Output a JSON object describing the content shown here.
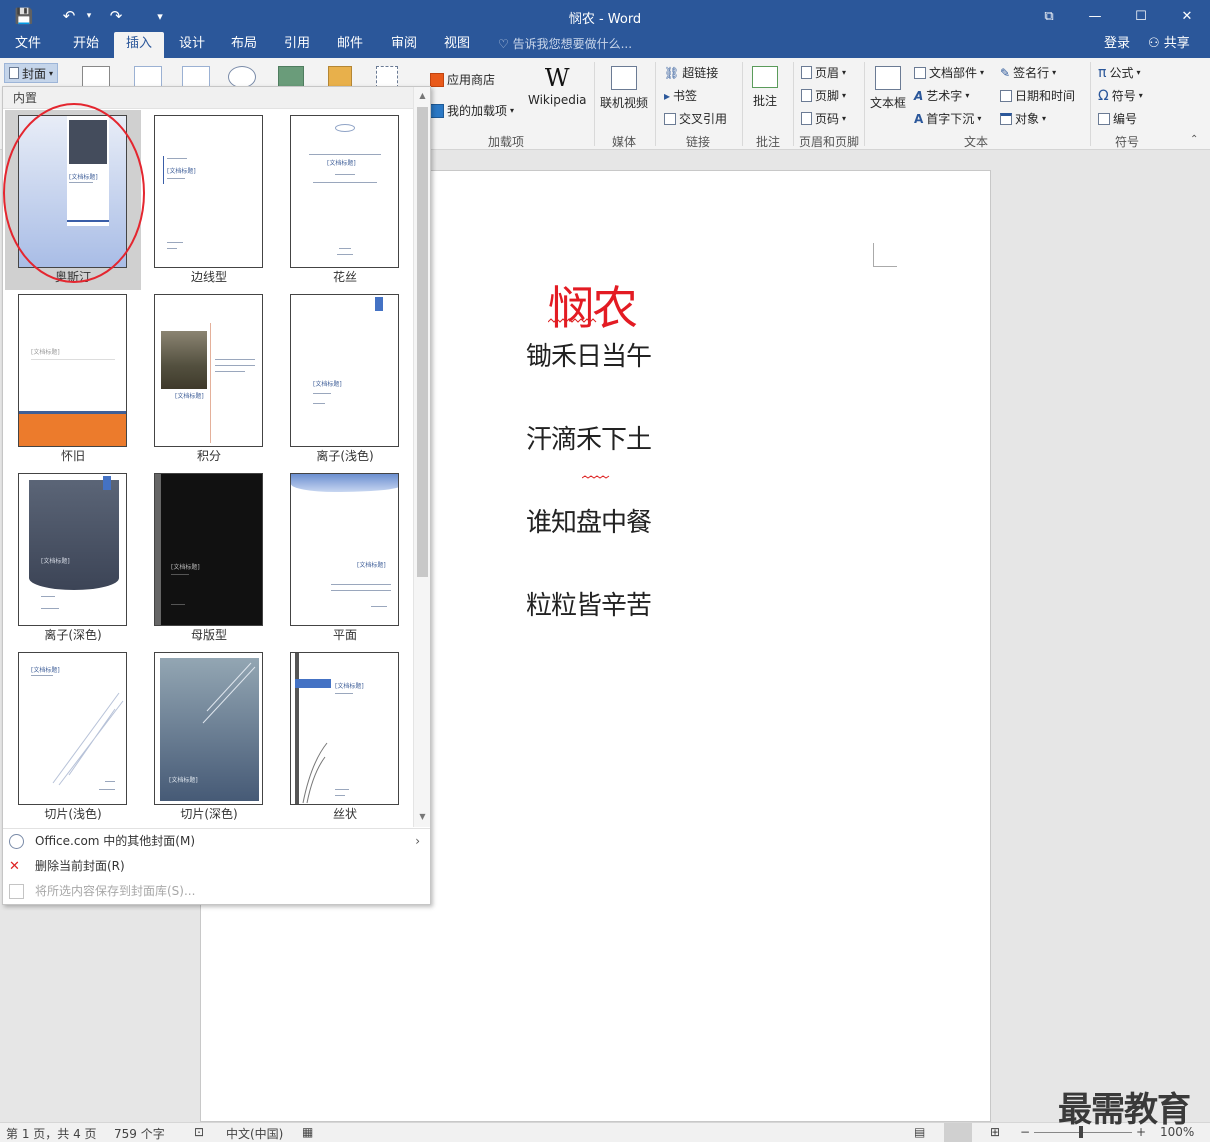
{
  "window": {
    "title": "悯农 - Word",
    "controls": {
      "restore_ribbon": "⧉",
      "minimize": "—",
      "maximize": "☐",
      "close": "✕"
    }
  },
  "quick_access": {
    "save": "💾",
    "undo": "↶",
    "redo": "↷",
    "customize": "▾"
  },
  "tabs": [
    {
      "label": "文件"
    },
    {
      "label": "开始"
    },
    {
      "label": "插入",
      "active": true
    },
    {
      "label": "设计"
    },
    {
      "label": "布局"
    },
    {
      "label": "引用"
    },
    {
      "label": "邮件"
    },
    {
      "label": "审阅"
    },
    {
      "label": "视图"
    }
  ],
  "tell_me": "告诉我您想要做什么...",
  "account": {
    "login": "登录",
    "share": "共享"
  },
  "ribbon": {
    "cover_button": "封面",
    "addins": {
      "store": "应用商店",
      "my_addins": "我的加载项",
      "wikipedia": "Wikipedia",
      "label": "加载项"
    },
    "media": {
      "online_video": "联机视频",
      "label": "媒体"
    },
    "links": {
      "hyperlink": "超链接",
      "bookmark": "书签",
      "cross_ref": "交叉引用",
      "label": "链接"
    },
    "comments": {
      "comment": "批注",
      "label": "批注"
    },
    "header_footer": {
      "header": "页眉",
      "footer": "页脚",
      "page_number": "页码",
      "label": "页眉和页脚"
    },
    "text": {
      "textbox": "文本框",
      "quick_parts": "文档部件",
      "wordart": "艺术字",
      "dropcap": "首字下沉",
      "signature": "签名行",
      "datetime": "日期和时间",
      "object": "对象",
      "label": "文本"
    },
    "symbols": {
      "equation": "公式",
      "symbol": "符号",
      "number": "编号",
      "label": "符号"
    }
  },
  "cover_gallery": {
    "header": "内置",
    "placeholder_title": "[文档标题]",
    "tiles": [
      {
        "name": "奥斯汀",
        "selected": true
      },
      {
        "name": "边线型"
      },
      {
        "name": "花丝"
      },
      {
        "name": "怀旧"
      },
      {
        "name": "积分"
      },
      {
        "name": "离子(浅色)"
      },
      {
        "name": "离子(深色)"
      },
      {
        "name": "母版型"
      },
      {
        "name": "平面"
      },
      {
        "name": "切片(浅色)"
      },
      {
        "name": "切片(深色)"
      },
      {
        "name": "丝状"
      }
    ],
    "menu": [
      {
        "label": "Office.com 中的其他封面(M)",
        "enabled": true,
        "submenu": "›"
      },
      {
        "label": "删除当前封面(R)",
        "enabled": true
      },
      {
        "label": "将所选内容保存到封面库(S)...",
        "enabled": false
      }
    ]
  },
  "document": {
    "title": "悯农",
    "lines": [
      "锄禾日当午",
      "汗滴禾下土",
      "谁知盘中餐",
      "粒粒皆辛苦"
    ]
  },
  "status": {
    "page": "第 1 页，共 4 页",
    "words": "759 个字",
    "language": "中文(中国)",
    "zoom": "100%"
  },
  "watermark": "最需教育",
  "colors": {
    "brand": "#2b579a",
    "title_red": "#e31b23",
    "highlight": "#e4262f"
  }
}
